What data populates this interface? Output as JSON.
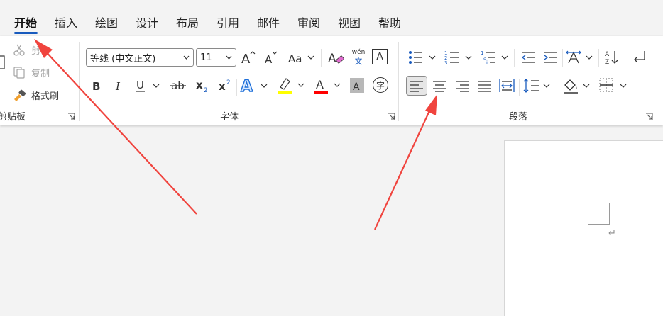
{
  "tabs": [
    {
      "label": "开始",
      "active": true
    },
    {
      "label": "插入"
    },
    {
      "label": "绘图"
    },
    {
      "label": "设计"
    },
    {
      "label": "布局"
    },
    {
      "label": "引用"
    },
    {
      "label": "邮件"
    },
    {
      "label": "审阅"
    },
    {
      "label": "视图"
    },
    {
      "label": "帮助"
    }
  ],
  "clipboard": {
    "cut_label": "剪切",
    "copy_label": "复制",
    "format_painter_label": "格式刷",
    "group_label": "剪贴板"
  },
  "font": {
    "font_name": "等线 (中文正文)",
    "font_size": "11",
    "phonetic_top": "wén",
    "phonetic_bottom": "文",
    "border_char": "A",
    "enclose_char": "字",
    "group_label": "字体"
  },
  "paragraph": {
    "group_label": "段落"
  },
  "colors": {
    "accent": "#185abd",
    "highlight": "#ffff00",
    "font_color": "#ff0000",
    "arrow": "#f0443e"
  },
  "document": {
    "paragraph_mark": "↵"
  }
}
